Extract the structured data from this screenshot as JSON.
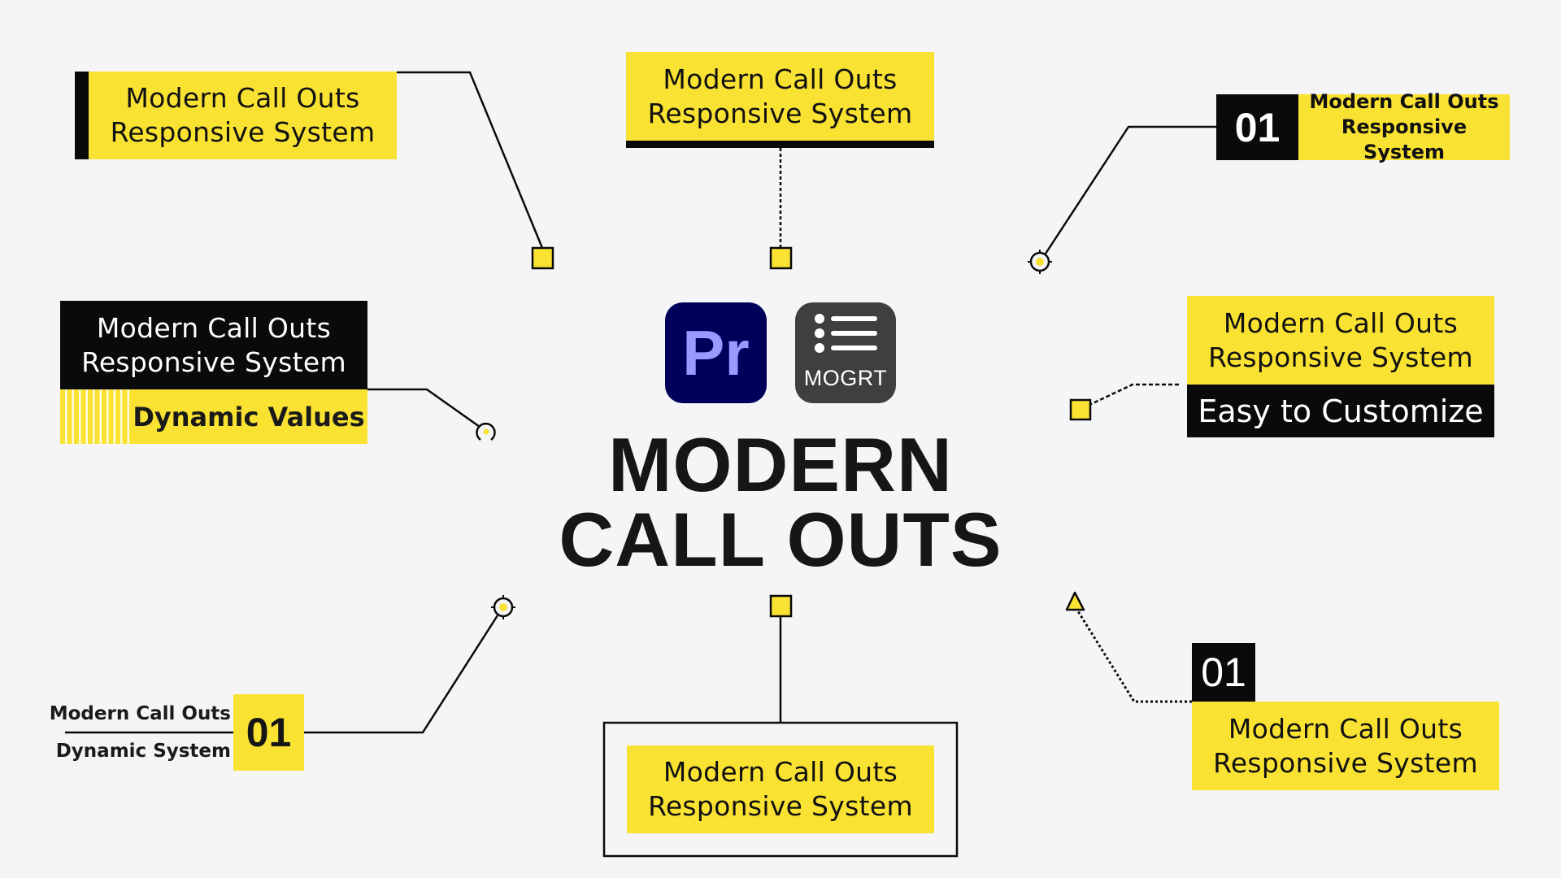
{
  "title": {
    "line1": "MODERN",
    "line2": "CALL OUTS"
  },
  "icons": {
    "premiere": {
      "label": "Pr",
      "name": "premiere-pro-icon",
      "bg": "#00005b",
      "fg": "#9999ff"
    },
    "mogrt": {
      "label": "MOGRT",
      "name": "mogrt-list-icon",
      "bg": "#3f3f3f",
      "fg": "#ffffff"
    }
  },
  "colors": {
    "accent_yellow": "#fae232",
    "ink": "#0a0a0a",
    "background": "#f5f5f7"
  },
  "callouts": {
    "top_left": {
      "line1": "Modern Call Outs",
      "line2": "Responsive System",
      "marker": "square"
    },
    "top_center": {
      "line1": "Modern Call Outs",
      "line2": "Responsive System",
      "marker": "square"
    },
    "top_right": {
      "number": "01",
      "line1": "Modern Call Outs",
      "line2": "Responsive System",
      "marker": "crosshair"
    },
    "mid_left": {
      "line1": "Modern Call Outs",
      "line2": "Responsive System",
      "subtitle": "Dynamic Values",
      "marker": "ring"
    },
    "mid_right": {
      "line1": "Modern Call Outs",
      "line2": "Responsive System",
      "subtitle": "Easy to Customize",
      "marker": "square"
    },
    "bottom_left": {
      "line1": "Modern Call Outs",
      "line2": "Dynamic System",
      "number": "01",
      "marker": "crosshair"
    },
    "bottom_center": {
      "line1": "Modern Call Outs",
      "line2": "Responsive System",
      "marker": "square"
    },
    "bottom_right": {
      "number": "01",
      "line1": "Modern Call Outs",
      "line2": "Responsive System",
      "marker": "triangle"
    }
  }
}
